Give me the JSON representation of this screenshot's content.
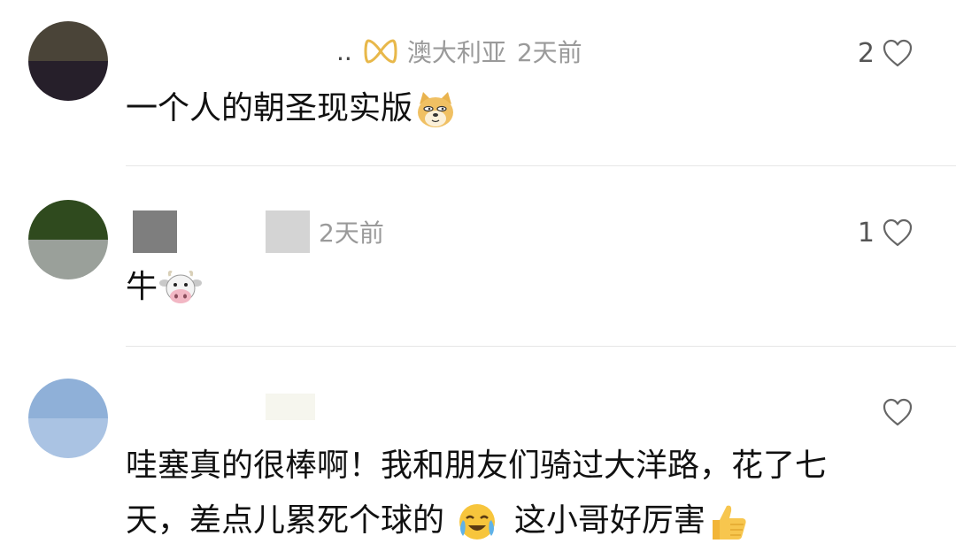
{
  "comments": [
    {
      "meta_prefix": "..",
      "location_badge_icon": "ribbon-badge-icon",
      "location": "澳大利亚",
      "time": "2天前",
      "likes": "2",
      "text": "一个人的朝圣现实版",
      "emoji": "doge-emoji-icon",
      "avatar_colors": [
        "#4a4438",
        "#261f2a"
      ]
    },
    {
      "time": "2天前",
      "likes": "1",
      "text": "牛",
      "emoji": "cow-face-emoji-icon",
      "avatar_colors": [
        "#2f4a1e",
        "#9aa09a"
      ],
      "redacted_colors": [
        "#7e7e7e",
        "#d4d4d4"
      ]
    },
    {
      "likes": "",
      "text_line1": "哇塞真的很棒啊！我和朋友们骑过大洋路，花了七",
      "text_line2": "天，差点儿累死个球的",
      "text_line3": "这小哥好厉害",
      "emoji1": "face-with-tears-emoji-icon",
      "emoji2": "thumbs-up-emoji-icon",
      "avatar_colors": [
        "#8fb0d8",
        "#aac3e3"
      ]
    }
  ],
  "colors": {
    "meta_gray": "#9a9a9a",
    "text": "#111111",
    "divider": "#e6e6e6",
    "badge_gold": "#e8b84a"
  }
}
